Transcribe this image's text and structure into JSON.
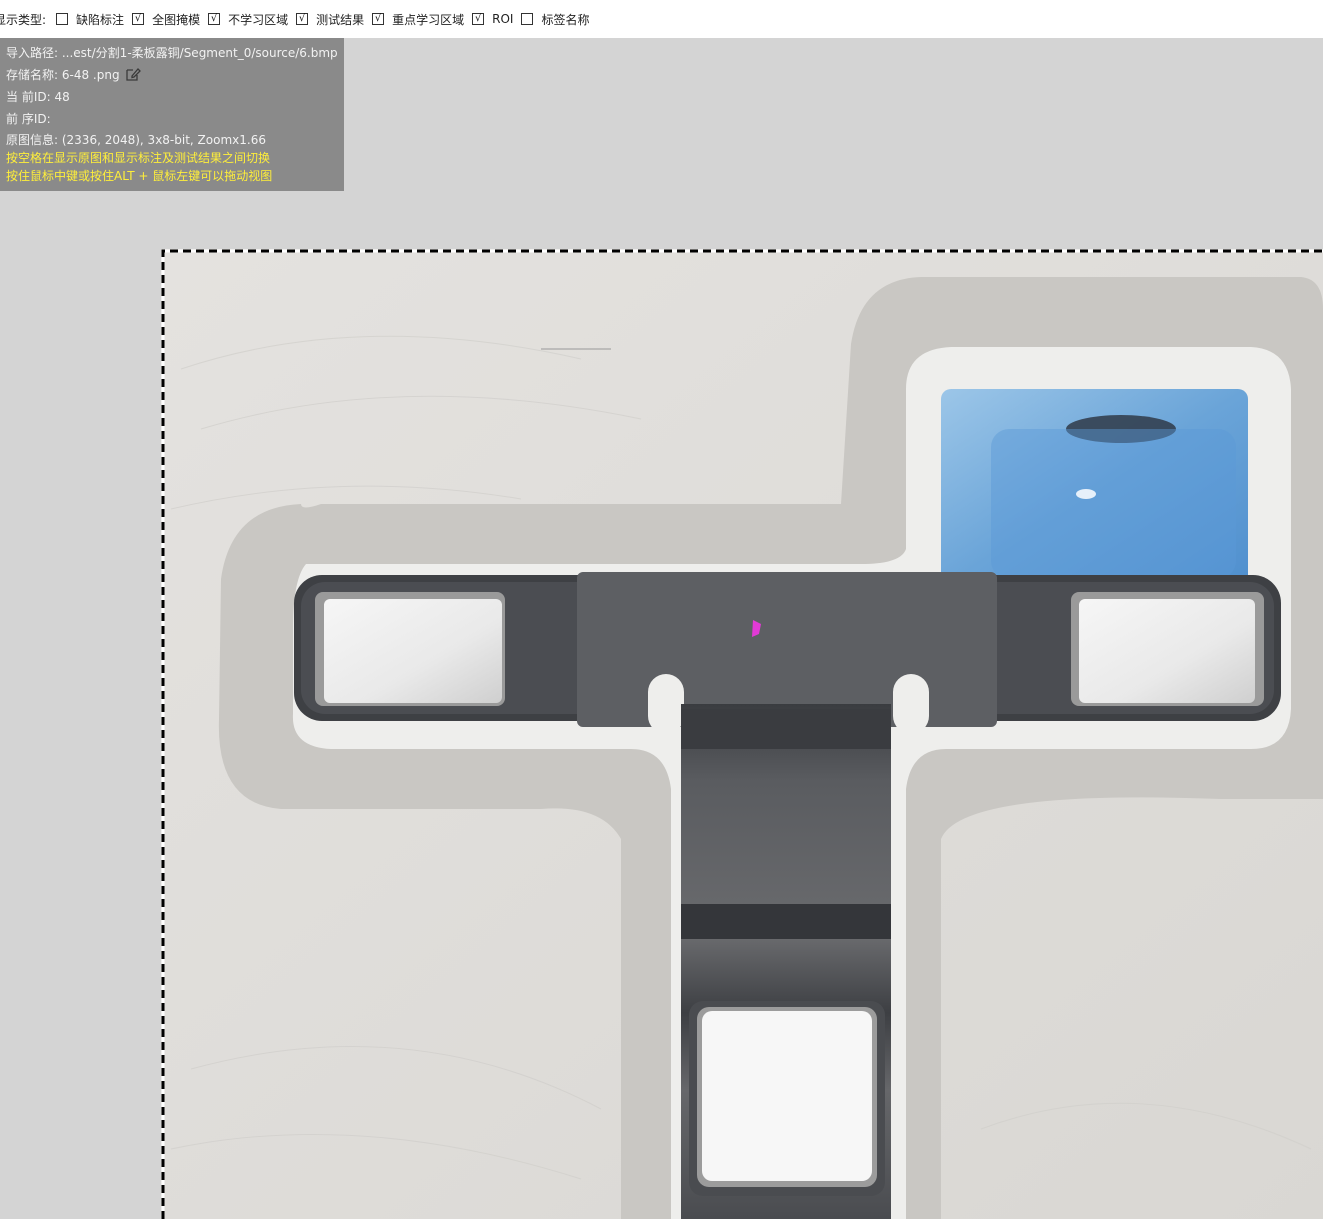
{
  "toolbar": {
    "label": "显示类型:",
    "options": [
      {
        "text": "缺陷标注",
        "checked": false
      },
      {
        "text": "全图掩模",
        "checked": true
      },
      {
        "text": "不学习区域",
        "checked": true
      },
      {
        "text": "测试结果",
        "checked": true
      },
      {
        "text": "重点学习区域",
        "checked": true
      },
      {
        "text": "ROI",
        "checked": true
      },
      {
        "text": "标签名称",
        "checked": false
      }
    ],
    "check_glyph": "√"
  },
  "info": {
    "path": "导入路径: ...est/分割1-柔板露铜/Segment_0/source/6.bmp",
    "save_name": "存储名称: 6-48  .png",
    "current_id": "当 前ID: 48",
    "prev_id": "前 序ID:",
    "image_info": "原图信息: (2336, 2048), 3x8-bit, Zoomx1.66",
    "hint_space": "按空格在显示原图和显示标注及测试结果之间切换",
    "hint_drag": "按住鼠标中键或按住ALT + 鼠标左键可以拖动视图",
    "edit_icon": "edit-icon"
  },
  "colors": {
    "page_bg": "#d4d4d4",
    "info_bg": "#8a8a8a",
    "hint": "#ffef3a",
    "defect_mark": "#e23ad6"
  }
}
